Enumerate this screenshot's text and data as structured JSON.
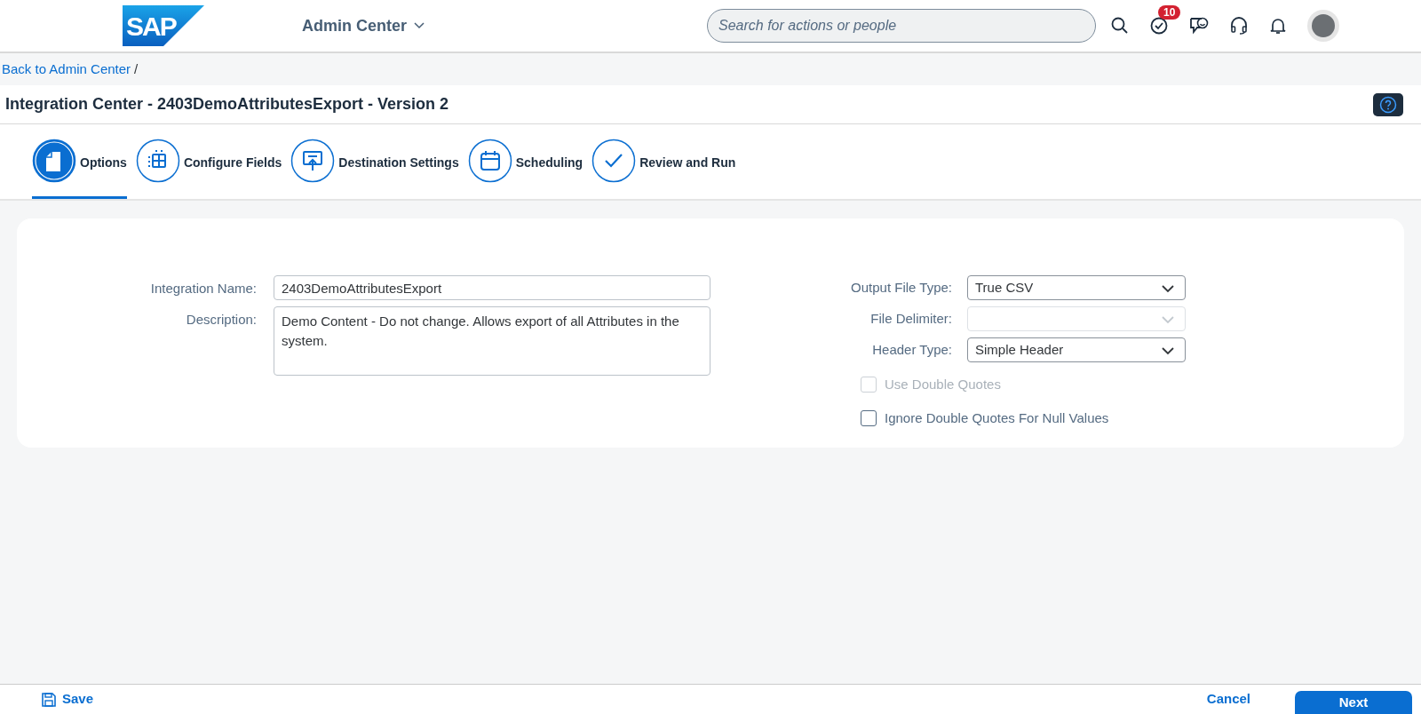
{
  "header": {
    "logo": "SAP",
    "app_title": "Admin Center",
    "search": {
      "placeholder": "Search for actions or people"
    },
    "tasks_badge": "10"
  },
  "breadcrumb": {
    "link": "Back to Admin Center",
    "separator": "/"
  },
  "page_title": "Integration Center - 2403DemoAttributesExport - Version 2",
  "steps": [
    {
      "label": "Options",
      "selected": true
    },
    {
      "label": "Configure Fields",
      "selected": false
    },
    {
      "label": "Destination Settings",
      "selected": false
    },
    {
      "label": "Scheduling",
      "selected": false
    },
    {
      "label": "Review and Run",
      "selected": false
    }
  ],
  "left_fields": [
    {
      "label": "Integration Name:",
      "kind": "input",
      "value": "2403DemoAttributesExport"
    },
    {
      "label": "Description:",
      "kind": "textarea",
      "value": "Demo Content - Do not change. Allows export of all Attributes in the system."
    }
  ],
  "right_fields": [
    {
      "label": "Output File Type:",
      "value": "True CSV",
      "disabled": false
    },
    {
      "label": "File Delimiter:",
      "disabled": true
    },
    {
      "label": "Header Type:",
      "value": "Simple Header",
      "disabled": false
    }
  ],
  "checkboxes": [
    {
      "label": "Use Double Quotes",
      "checked": false,
      "disabled": true
    },
    {
      "label": "Ignore Double Quotes For Null Values",
      "checked": false,
      "disabled": false
    }
  ],
  "footer": {
    "save": "Save",
    "cancel": "Cancel",
    "next": "Next"
  }
}
